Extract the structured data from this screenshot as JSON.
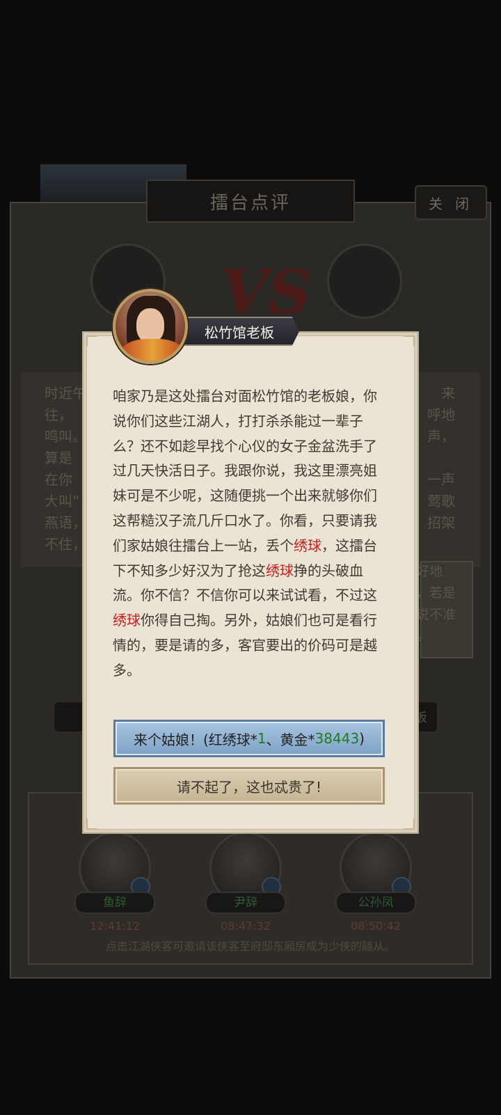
{
  "background": {
    "panel_title": "擂台点评",
    "close_label": "关 闭",
    "vs_text": "VS",
    "story_lines_left": [
      "时近午",
      "往，",
      "鸣叫。",
      "算是",
      "在你",
      "大叫“",
      "燕语，",
      "不住，"
    ],
    "story_lines_right": [
      "来",
      "呼地",
      "声，",
      "一声",
      "莺歌",
      "招架"
    ],
    "card_lines": [
      "好地",
      "，若是",
      "说不准",
      "。"
    ],
    "bar_right_label": "板",
    "heroes": [
      {
        "name": "鱼辞",
        "timer": "12:41:12"
      },
      {
        "name": "尹辞",
        "timer": "08:47:32"
      },
      {
        "name": "公孙凤",
        "timer": "08:50:42"
      }
    ],
    "hint": "点击江湖侠客可邀请该侠客至府邸东厢房成为少侠的随从。"
  },
  "dialog": {
    "speaker": "松竹馆老板",
    "text_parts": [
      "咱家乃是这处擂台对面松竹馆的老板娘，你说你们这些江湖人，打打杀杀能过一辈子么？还不如趁早找个心仪的女子金盆洗手了过几天快活日子。我跟你说，我这里漂亮姐妹可是不少呢，这随便挑一个出来就够你们这帮糙汉子流几斤口水了。你看，只要请我们家姑娘往擂台上一站，丢个",
      "绣球",
      "，这擂台下不知多少好汉为了抢这",
      "绣球",
      "挣的头破血流。你不信？不信你可以来试试看，不过这",
      "绣球",
      "你得自己掏。另外，姑娘们也可是看行情的，要是请的多，客官要出的价码可是越多。"
    ],
    "accept": {
      "prefix": "来个姑娘！(红绣球*",
      "qty": "1",
      "middle": "、黄金*",
      "gold": "38443",
      "suffix": ")"
    },
    "decline_label": "请不起了，这也忒贵了!"
  },
  "colors": {
    "highlight_red": "#cf1a1a",
    "highlight_green": "#1f7d1f",
    "dialog_bg": "#ebe3d4"
  }
}
